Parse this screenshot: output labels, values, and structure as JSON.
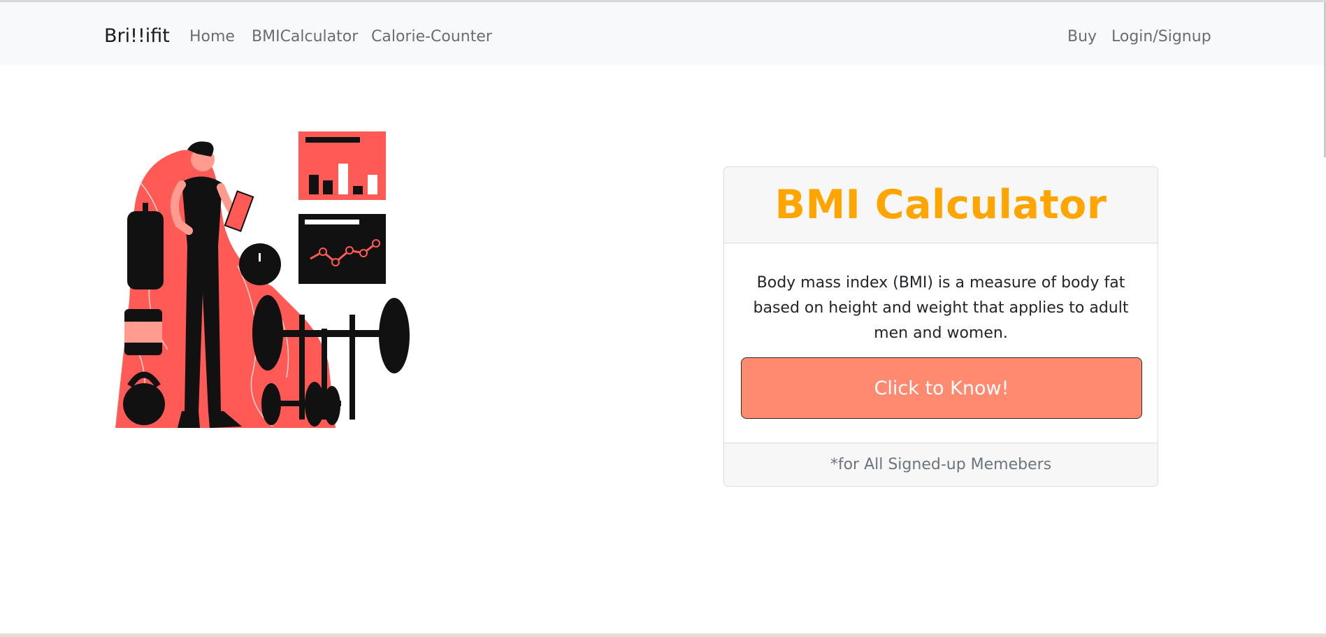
{
  "nav": {
    "brand": "Bri!!ifit",
    "links": [
      "Home",
      "BMICalculator",
      "Calorie-Counter"
    ],
    "right_links": [
      "Buy",
      "Login/Signup"
    ]
  },
  "hero": {
    "image_icon": "fitness-trainer-illustration"
  },
  "card": {
    "title": "BMI Calculator",
    "description": "Body mass index (BMI) is a measure of body fat based on height and weight that applies to adult men and women.",
    "button_label": "Click to Know!",
    "footer": "*for All Signed-up Memebers"
  },
  "colors": {
    "accent_orange": "#ffa500",
    "button_coral": "#ff8a70",
    "illustration_red": "#ff5a55",
    "navbar_bg": "#f8f9fa"
  }
}
